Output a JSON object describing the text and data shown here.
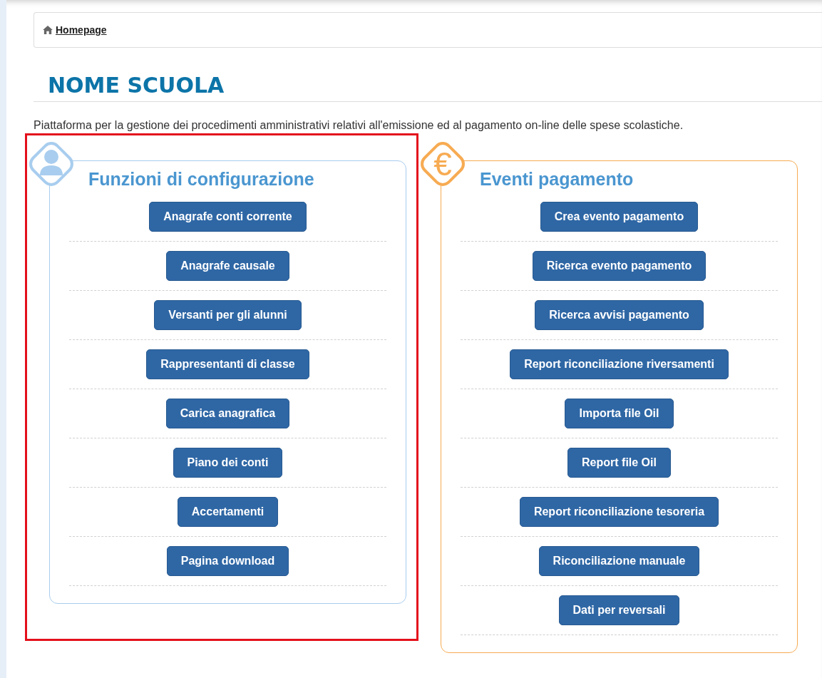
{
  "breadcrumb": {
    "label": "Homepage"
  },
  "title": "NOME SCUOLA",
  "description": "Piattaforma per la gestione dei procedimenti amministrativi relativi all'emissione ed al pagamento on-line delle spese scolastiche.",
  "panels": [
    {
      "kind": "person",
      "color": "#a8cdee",
      "highlighted": true,
      "title": "Funzioni di configurazione",
      "buttons": [
        "Anagrafe conti corrente",
        "Anagrafe causale",
        "Versanti per gli alunni",
        "Rappresentanti di classe",
        "Carica anagrafica",
        "Piano dei conti",
        "Accertamenti",
        "Pagina download"
      ]
    },
    {
      "kind": "euro",
      "color": "#f7ab52",
      "highlighted": false,
      "title": "Eventi pagamento",
      "symbol": "€",
      "buttons": [
        "Crea evento pagamento",
        "Ricerca evento pagamento",
        "Ricerca avvisi pagamento",
        "Report riconciliazione riversamenti",
        "Importa file Oil",
        "Report file Oil",
        "Report riconciliazione tesoreria",
        "Riconciliazione manuale",
        "Dati per reversali"
      ]
    }
  ]
}
